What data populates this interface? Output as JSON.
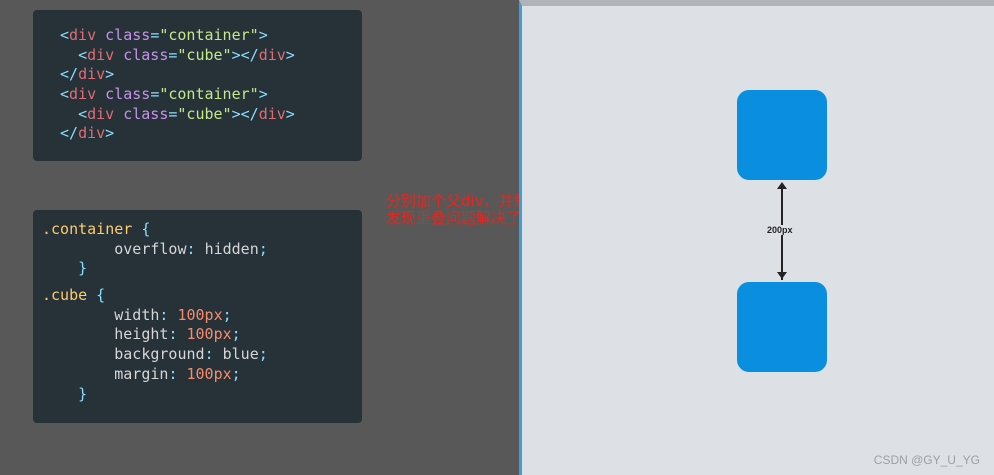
{
  "html_code": {
    "lines": [
      [
        {
          "t": "<",
          "c": "punct"
        },
        {
          "t": "div",
          "c": "tag"
        },
        {
          "t": " class",
          "c": "attr"
        },
        {
          "t": "=",
          "c": "punct"
        },
        {
          "t": "\"container\"",
          "c": "str"
        },
        {
          "t": ">",
          "c": "punct"
        }
      ],
      [
        {
          "t": "  "
        },
        {
          "t": "<",
          "c": "punct"
        },
        {
          "t": "div",
          "c": "tag"
        },
        {
          "t": " class",
          "c": "attr"
        },
        {
          "t": "=",
          "c": "punct"
        },
        {
          "t": "\"cube\"",
          "c": "str"
        },
        {
          "t": "></",
          "c": "punct"
        },
        {
          "t": "div",
          "c": "tag"
        },
        {
          "t": ">",
          "c": "punct"
        }
      ],
      [
        {
          "t": "</",
          "c": "punct"
        },
        {
          "t": "div",
          "c": "tag"
        },
        {
          "t": ">",
          "c": "punct"
        }
      ],
      [
        {
          "t": "<",
          "c": "punct"
        },
        {
          "t": "div",
          "c": "tag"
        },
        {
          "t": " class",
          "c": "attr"
        },
        {
          "t": "=",
          "c": "punct"
        },
        {
          "t": "\"container\"",
          "c": "str"
        },
        {
          "t": ">",
          "c": "punct"
        }
      ],
      [
        {
          "t": "  "
        },
        {
          "t": "<",
          "c": "punct"
        },
        {
          "t": "div",
          "c": "tag"
        },
        {
          "t": " class",
          "c": "attr"
        },
        {
          "t": "=",
          "c": "punct"
        },
        {
          "t": "\"cube\"",
          "c": "str"
        },
        {
          "t": "></",
          "c": "punct"
        },
        {
          "t": "div",
          "c": "tag"
        },
        {
          "t": ">",
          "c": "punct"
        }
      ],
      [
        {
          "t": "</",
          "c": "punct"
        },
        {
          "t": "div",
          "c": "tag"
        },
        {
          "t": ">",
          "c": "punct"
        }
      ]
    ]
  },
  "css_code": {
    "lines": [
      [
        {
          "t": ".container",
          "c": "sel"
        },
        {
          "t": " {",
          "c": "punct"
        }
      ],
      [
        {
          "t": "        "
        },
        {
          "t": "overflow",
          "c": "prop"
        },
        {
          "t": ": ",
          "c": "punct"
        },
        {
          "t": "hidden",
          "c": "prop"
        },
        {
          "t": ";",
          "c": "punct"
        }
      ],
      [
        {
          "t": "    "
        },
        {
          "t": "}",
          "c": "punct"
        }
      ],
      [],
      [
        {
          "t": ".cube",
          "c": "sel"
        },
        {
          "t": " {",
          "c": "punct"
        }
      ],
      [
        {
          "t": "        "
        },
        {
          "t": "width",
          "c": "prop"
        },
        {
          "t": ": ",
          "c": "punct"
        },
        {
          "t": "100px",
          "c": "num"
        },
        {
          "t": ";",
          "c": "punct"
        }
      ],
      [
        {
          "t": "        "
        },
        {
          "t": "height",
          "c": "prop"
        },
        {
          "t": ": ",
          "c": "punct"
        },
        {
          "t": "100px",
          "c": "num"
        },
        {
          "t": ";",
          "c": "punct"
        }
      ],
      [
        {
          "t": "        "
        },
        {
          "t": "background",
          "c": "prop"
        },
        {
          "t": ": ",
          "c": "punct"
        },
        {
          "t": "blue",
          "c": "prop"
        },
        {
          "t": ";",
          "c": "punct"
        }
      ],
      [
        {
          "t": "        "
        },
        {
          "t": "margin",
          "c": "prop"
        },
        {
          "t": ": ",
          "c": "punct"
        },
        {
          "t": "100px",
          "c": "num"
        },
        {
          "t": ";",
          "c": "punct"
        }
      ],
      [
        {
          "t": "    "
        },
        {
          "t": "}",
          "c": "punct"
        }
      ]
    ]
  },
  "annotation": {
    "line1": "分别加个父div，并触发BFC",
    "line2": "发现重叠问题解决了"
  },
  "preview": {
    "gap_label": "200px",
    "cube_color": "#0a8fe0"
  },
  "watermark": "CSDN @GY_U_YG"
}
